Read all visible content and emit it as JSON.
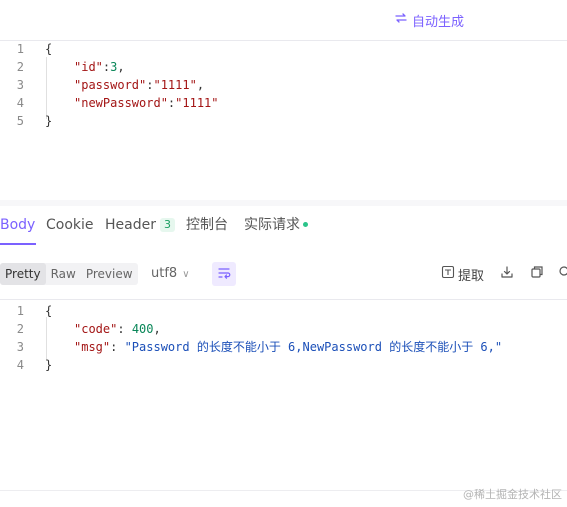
{
  "header": {
    "auto_generate_label": "自动生成"
  },
  "request_body": {
    "lines": [
      {
        "n": "1",
        "indent": false,
        "parts": [
          {
            "t": "{",
            "c": "punct"
          }
        ]
      },
      {
        "n": "2",
        "indent": true,
        "parts": [
          {
            "t": "\"id\"",
            "c": "str-key"
          },
          {
            "t": ":",
            "c": "punct"
          },
          {
            "t": "3",
            "c": "num"
          },
          {
            "t": ",",
            "c": "punct"
          }
        ]
      },
      {
        "n": "3",
        "indent": true,
        "parts": [
          {
            "t": "\"password\"",
            "c": "str-key"
          },
          {
            "t": ":",
            "c": "punct"
          },
          {
            "t": "\"1111\"",
            "c": "str-val"
          },
          {
            "t": ",",
            "c": "punct"
          }
        ]
      },
      {
        "n": "4",
        "indent": true,
        "parts": [
          {
            "t": "\"newPassword\"",
            "c": "str-key"
          },
          {
            "t": ":",
            "c": "punct"
          },
          {
            "t": "\"1111\"",
            "c": "str-val"
          }
        ]
      },
      {
        "n": "5",
        "indent": false,
        "parts": [
          {
            "t": "}",
            "c": "punct"
          }
        ]
      }
    ]
  },
  "response_tabs": [
    {
      "label": "Body",
      "active": true
    },
    {
      "label": "Cookie",
      "active": false
    },
    {
      "label": "Header",
      "badge": "3",
      "active": false
    },
    {
      "label": "控制台",
      "active": false
    },
    {
      "label": "实际请求",
      "dot": true,
      "active": false
    }
  ],
  "toolbar": {
    "view_modes": [
      {
        "label": "Pretty",
        "active": true
      },
      {
        "label": "Raw",
        "active": false
      },
      {
        "label": "Preview",
        "active": false
      }
    ],
    "encoding": "utf8",
    "extract_label": "提取"
  },
  "response_body": {
    "lines": [
      {
        "n": "1",
        "indent": false,
        "parts": [
          {
            "t": "{",
            "c": "punct"
          }
        ]
      },
      {
        "n": "2",
        "indent": true,
        "parts": [
          {
            "t": "\"code\"",
            "c": "str-key"
          },
          {
            "t": ": ",
            "c": "punct"
          },
          {
            "t": "400",
            "c": "num"
          },
          {
            "t": ",",
            "c": "punct"
          }
        ]
      },
      {
        "n": "3",
        "indent": true,
        "parts": [
          {
            "t": "\"msg\"",
            "c": "str-key"
          },
          {
            "t": ": ",
            "c": "punct"
          },
          {
            "t": "\"Password 的长度不能小于 6,NewPassword 的长度不能小于 6,\"",
            "c": "str-blue"
          }
        ]
      },
      {
        "n": "4",
        "indent": false,
        "parts": [
          {
            "t": "}",
            "c": "punct"
          }
        ]
      }
    ]
  },
  "watermark": "@稀土掘金技术社区",
  "colors": {
    "accent": "#7b61ff",
    "badge_green": "#1a9e61",
    "dot_green": "#2bc48a"
  },
  "icons": [
    "sync-icon",
    "wrap-lines-icon",
    "extract-icon",
    "download-icon",
    "copy-icon",
    "search-icon"
  ]
}
